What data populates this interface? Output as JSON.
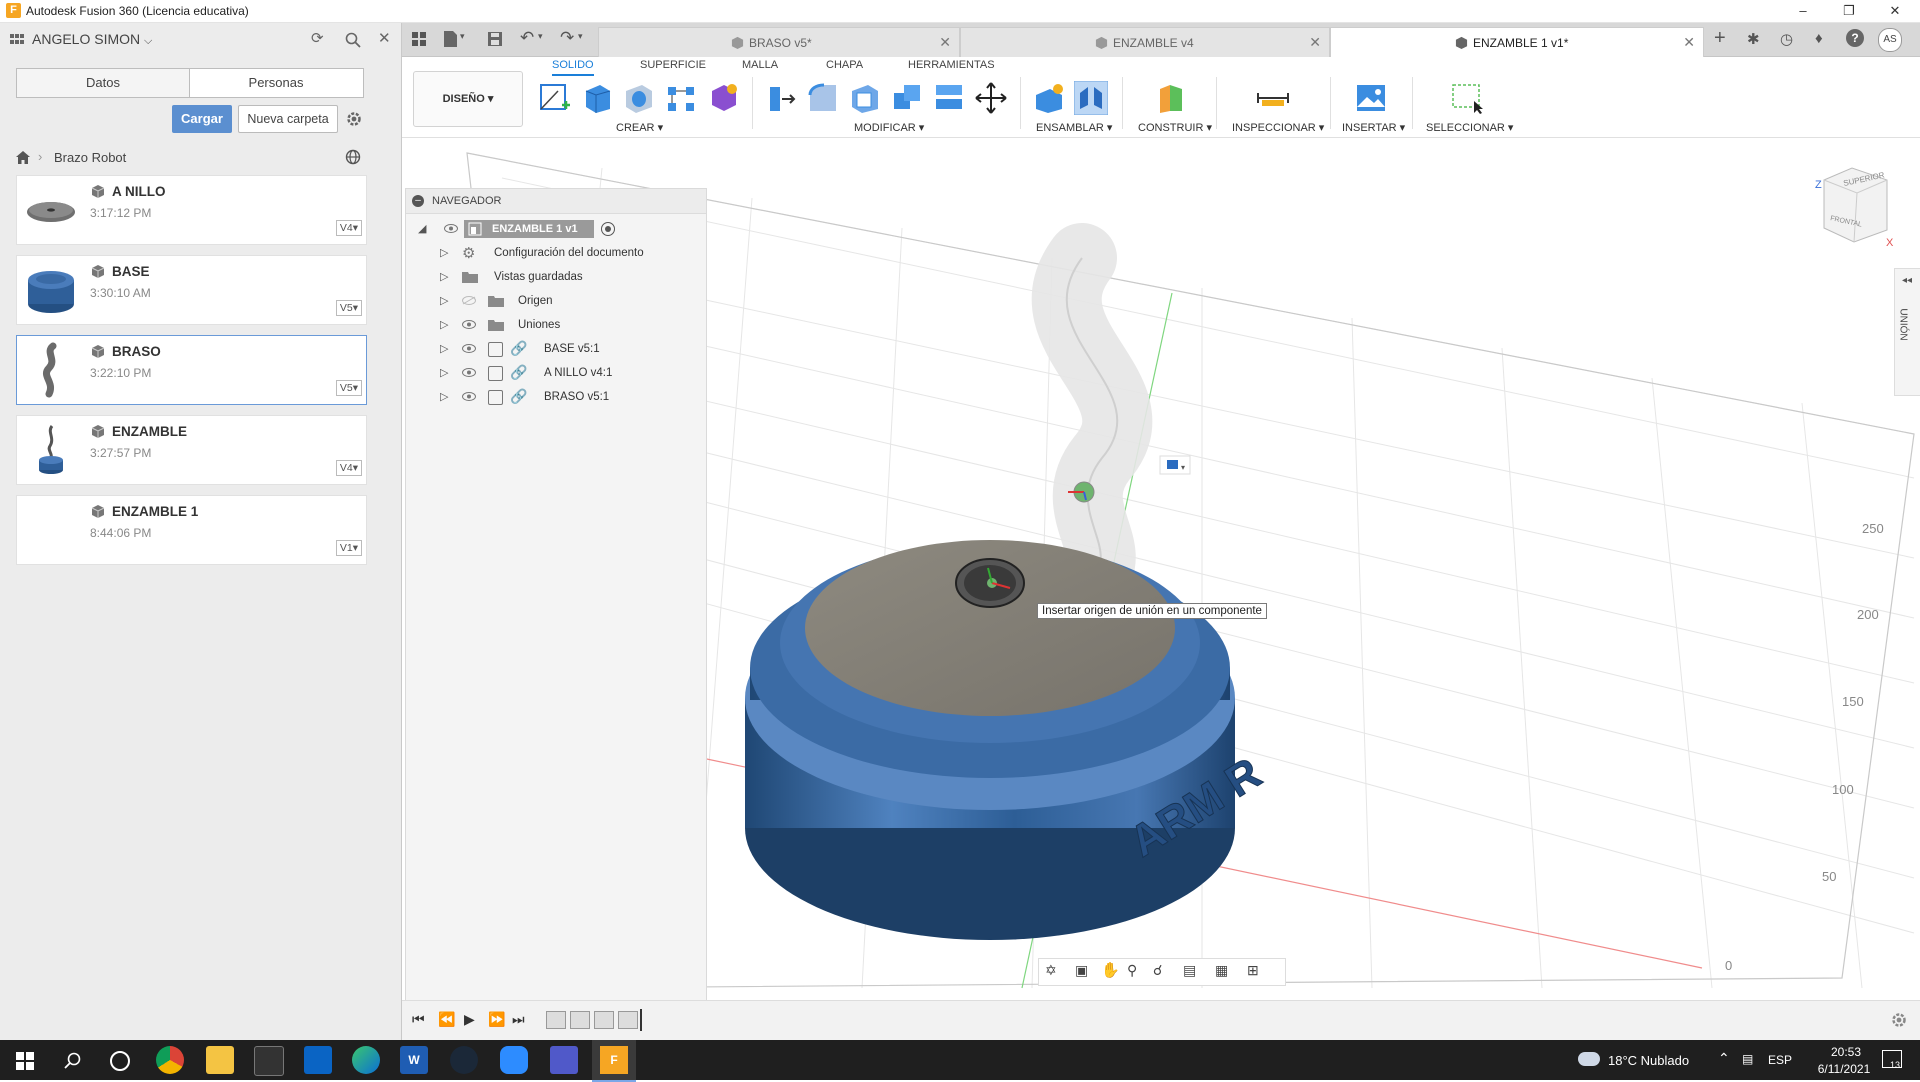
{
  "window": {
    "title": "Autodesk Fusion 360 (Licencia educativa)",
    "app_icon": "F"
  },
  "data_panel": {
    "user": "ANGELO SIMON",
    "tabs": [
      "Datos",
      "Personas"
    ],
    "upload_label": "Cargar",
    "new_folder_label": "Nueva carpeta",
    "breadcrumb": "Brazo Robot",
    "files": [
      {
        "name": "A NILLO",
        "time": "3:17:12 PM",
        "version": "V4"
      },
      {
        "name": "BASE",
        "time": "3:30:10 AM",
        "version": "V5"
      },
      {
        "name": "BRASO",
        "time": "3:22:10 PM",
        "version": "V5",
        "selected": true
      },
      {
        "name": "ENZAMBLE",
        "time": "3:27:57 PM",
        "version": "V4"
      },
      {
        "name": "ENZAMBLE 1",
        "time": "8:44:06 PM",
        "version": "V1"
      }
    ]
  },
  "doc_tabs": [
    {
      "label": "BRASO v5*"
    },
    {
      "label": "ENZAMBLE v4"
    },
    {
      "label": "ENZAMBLE 1 v1*",
      "active": true
    }
  ],
  "toolbar": {
    "workspace_tabs": [
      "SOLIDO",
      "SUPERFICIE",
      "MALLA",
      "CHAPA",
      "HERRAMIENTAS"
    ],
    "design_label": "DISEÑO",
    "groups": [
      "CREAR",
      "MODIFICAR",
      "ENSAMBLAR",
      "CONSTRUIR",
      "INSPECCIONAR",
      "INSERTAR",
      "SELECCIONAR"
    ],
    "user_initials": "AS"
  },
  "navigator": {
    "title": "NAVEGADOR",
    "root": "ENZAMBLE 1 v1",
    "items": [
      {
        "label": "Configuración del documento",
        "icon": "gear-icon"
      },
      {
        "label": "Vistas guardadas",
        "icon": "folder-icon"
      },
      {
        "label": "Origen",
        "icon": "folder-icon",
        "hidden": true
      },
      {
        "label": "Uniones",
        "icon": "folder-icon"
      },
      {
        "label": "BASE v5:1",
        "icon": "link-icon"
      },
      {
        "label": "A NILLO v4:1",
        "icon": "link-icon"
      },
      {
        "label": "BRASO v5:1",
        "icon": "link-icon"
      }
    ]
  },
  "viewport": {
    "tooltip": "Insertar origen de unión en un componente",
    "viewcube": {
      "top": "SUPERIOR",
      "front": "FRONTAL"
    },
    "side_panel_label": "UNIÓN",
    "ruler": [
      "250",
      "200",
      "150",
      "100",
      "50",
      "0"
    ],
    "engraving": "ARM R"
  },
  "taskbar": {
    "weather": "18°C  Nublado",
    "language": "ESP",
    "time": "20:53",
    "date": "6/11/2021",
    "notifications": "13"
  },
  "colors": {
    "accent": "#1a7fd9",
    "primary_button": "#5b8fd0",
    "model_blue": "#3d6ea8",
    "model_top": "#85827a"
  }
}
